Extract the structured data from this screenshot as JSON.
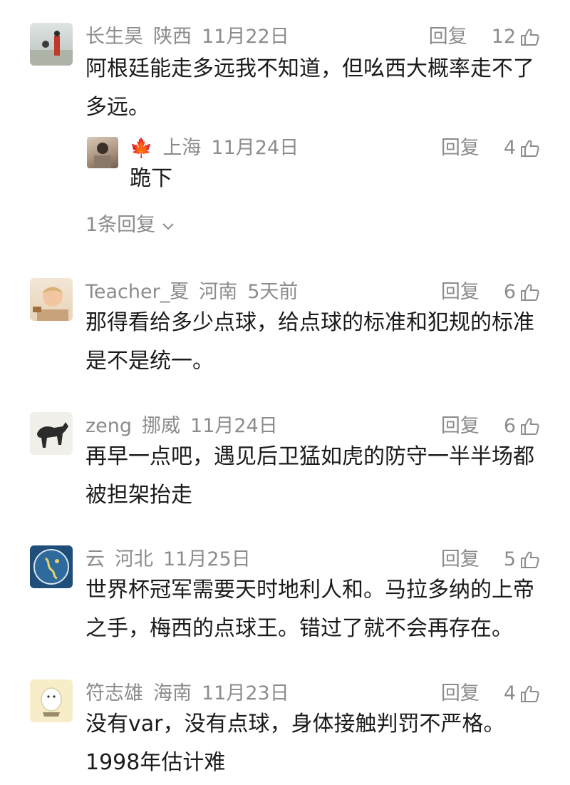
{
  "reply_label": "回复",
  "comments": [
    {
      "user": "长生昊",
      "location": "陕西",
      "time": "11月22日",
      "likes": "12",
      "text": "阿根廷能走多远我不知道，但吆西大概率走不了多远。",
      "reply": {
        "location": "上海",
        "time": "11月24日",
        "likes": "4",
        "text": "跪下"
      },
      "more_replies": "1条回复"
    },
    {
      "user": "Teacher_夏",
      "location": "河南",
      "time": "5天前",
      "likes": "6",
      "text": "那得看给多少点球，给点球的标准和犯规的标准是不是统一。"
    },
    {
      "user": "zeng",
      "location": "挪威",
      "time": "11月24日",
      "likes": "6",
      "text": "再早一点吧，遇见后卫猛如虎的防守一半半场都被担架抬走"
    },
    {
      "user": "云",
      "location": "河北",
      "time": "11月25日",
      "likes": "5",
      "text": "世界杯冠军需要天时地利人和。马拉多纳的上帝之手，梅西的点球王。错过了就不会再存在。"
    },
    {
      "user": "符志雄",
      "location": "海南",
      "time": "11月23日",
      "likes": "4",
      "text": "没有var，没有点球，身体接触判罚不严格。1998年估计难"
    }
  ],
  "icons": {
    "like": "thumbs-up-icon",
    "expand": "chevron-down-icon",
    "maple": "maple-leaf-icon"
  },
  "colors": {
    "meta": "#8c8c8c",
    "text": "#1b1b1b",
    "maple": "#e2826a"
  }
}
